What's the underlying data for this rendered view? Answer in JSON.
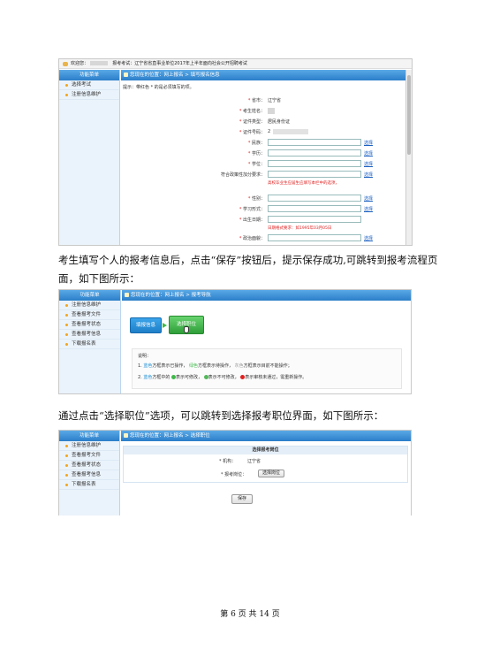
{
  "shot1": {
    "welcome_prefix": "欢迎您：",
    "welcome_suffix": "报考考试：辽宁省省直事业单位2017年上半年面向社会公开招聘考试",
    "menu_title": "功能菜单",
    "menu_items": [
      "选择考试",
      "注册信息维护"
    ],
    "breadcrumb": "您现在的位置：网上报名 > 填写报名信息",
    "hint": "提示：带红色 * 的是必须填写的项。",
    "fields": [
      {
        "label": "省市：",
        "value": "辽宁省",
        "required": true
      },
      {
        "label": "考生姓名：",
        "value": "",
        "required": true
      },
      {
        "label": "证件类型：",
        "value": "居民身份证",
        "required": true
      },
      {
        "label": "证件号码：",
        "value": "2",
        "required": true
      },
      {
        "label": "民族：",
        "required": true,
        "link": "选择"
      },
      {
        "label": "学历：",
        "required": true,
        "link": "选择"
      },
      {
        "label": "学位：",
        "required": true,
        "link": "选择"
      },
      {
        "label": "符合政策性加分要求：",
        "required": false,
        "link": "选择",
        "note": "高校毕业生应届生应填写本栏中的选项，"
      },
      {
        "label": "性别：",
        "required": true,
        "link": "选择"
      },
      {
        "label": "学习形式：",
        "required": true,
        "link": "选择"
      },
      {
        "label": "出生日期：",
        "required": true,
        "note": "日期格式要求：如1995年03月05日"
      },
      {
        "label": "政治面貌：",
        "required": true,
        "link": "选择"
      }
    ]
  },
  "para1_line1": "考生填写个人的报考信息后，点击“保存”按钮后，提示保存成功,可跳转到报考流程页",
  "para1_line2": "面，如下图所示：",
  "shot2": {
    "menu_title": "功能菜单",
    "menu_items": [
      "注册信息维护",
      "查看报考文件",
      "查看报考状态",
      "查看报考信息",
      "下载报名表"
    ],
    "breadcrumb": "您现在的位置：网上报名 > 报考导航",
    "step1": "填报信息",
    "step2": "选择职位",
    "note_title": "说明：",
    "note1_pre": "1.",
    "note1_blue": "蓝色",
    "note1_a": "方框表示已操作，",
    "note1_green": "绿色",
    "note1_b": "方框表示待操作，",
    "note1_gray": "灰色",
    "note1_c": "方框表示目前不能操作；",
    "note2_pre": "2.",
    "note2_blue": "蓝色",
    "note2_a": "方框中的",
    "note2_b": "表示可修改，",
    "note2_c": "表示不可修改，",
    "note2_d": "表示审核未通过，需重新操作。"
  },
  "para2": "通过点击“选择职位”选项，可以跳转到选择报考职位界面，如下图所示：",
  "shot3": {
    "menu_title": "功能菜单",
    "menu_items": [
      "注册信息维护",
      "查看报考文件",
      "查看报考状态",
      "查看报考信息",
      "下载报名表"
    ],
    "breadcrumb": "您现在的位置：网上报名 > 选择职位",
    "panel_title": "选择报考岗位",
    "org_label": "* 机构：",
    "org_value": "辽宁省",
    "post_label": "* 报考岗位：",
    "post_button": "选择岗位",
    "save_button": "保存"
  },
  "footer": "第 6 页 共 14 页",
  "colors": {
    "accent": "#2b7ec9",
    "required": "#e02020",
    "link": "#1a5fc0",
    "step_blue": "#1f8fd6",
    "step_green": "#3fb94a"
  }
}
